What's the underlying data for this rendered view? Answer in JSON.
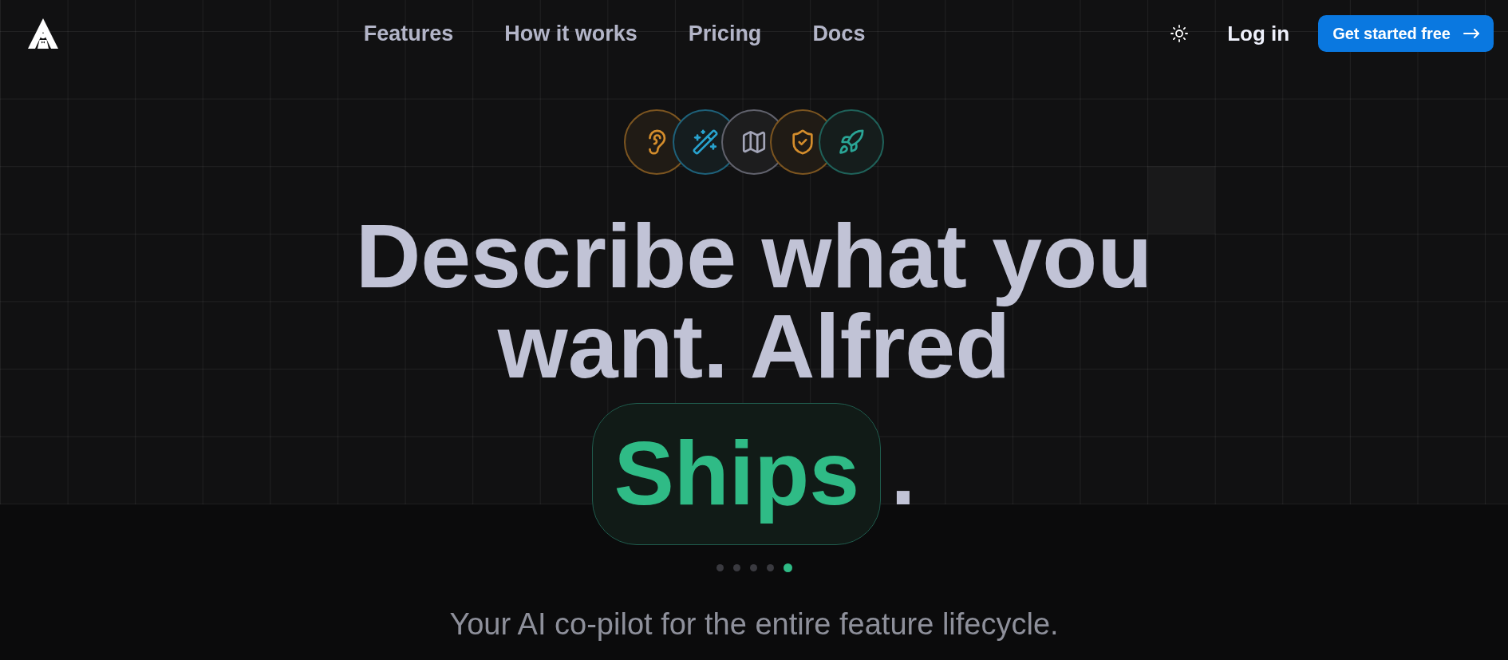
{
  "nav": {
    "links": [
      "Features",
      "How it works",
      "Pricing",
      "Docs"
    ],
    "login": "Log in",
    "cta": "Get started free"
  },
  "hero": {
    "icons": [
      {
        "kind": "ear",
        "color": "#d48d2c"
      },
      {
        "kind": "wand",
        "color": "#28a3cf"
      },
      {
        "kind": "map",
        "color": "#a3a5b8"
      },
      {
        "kind": "shield",
        "color": "#d48d2c"
      },
      {
        "kind": "rocket",
        "color": "#2aa596"
      }
    ],
    "headline": "Describe what you want. Alfred",
    "highlight": "Ships",
    "end": ".",
    "slides": [
      {
        "selected": false
      },
      {
        "selected": false
      },
      {
        "selected": false
      },
      {
        "selected": false
      },
      {
        "selected": true
      }
    ],
    "subtitle": "Your AI co-pilot for the entire feature lifecycle."
  }
}
